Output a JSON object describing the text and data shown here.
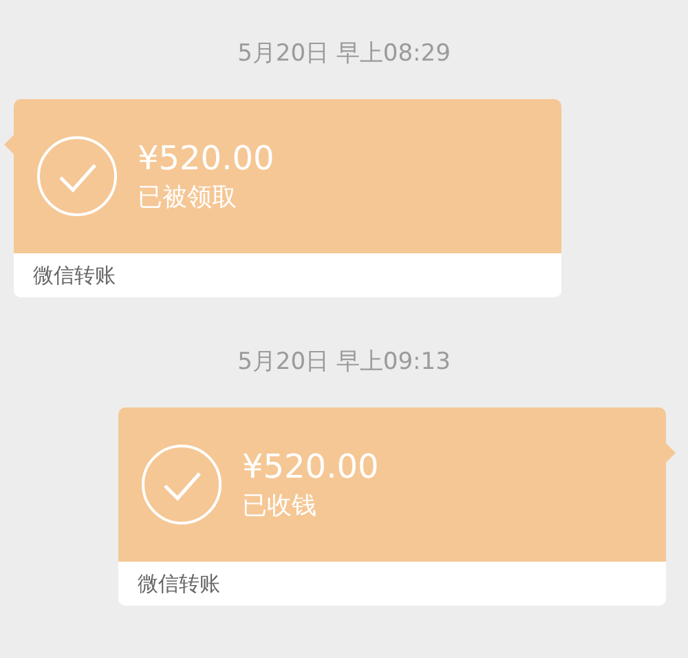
{
  "messages": [
    {
      "time": "5月20日 早上08:29",
      "kind": "incoming",
      "amount": "¥520.00",
      "status": "已被领取",
      "footer": "微信转账"
    },
    {
      "time": "5月20日 早上09:13",
      "kind": "outgoing",
      "amount": "¥520.00",
      "status": "已收钱",
      "footer": "微信转账"
    }
  ]
}
